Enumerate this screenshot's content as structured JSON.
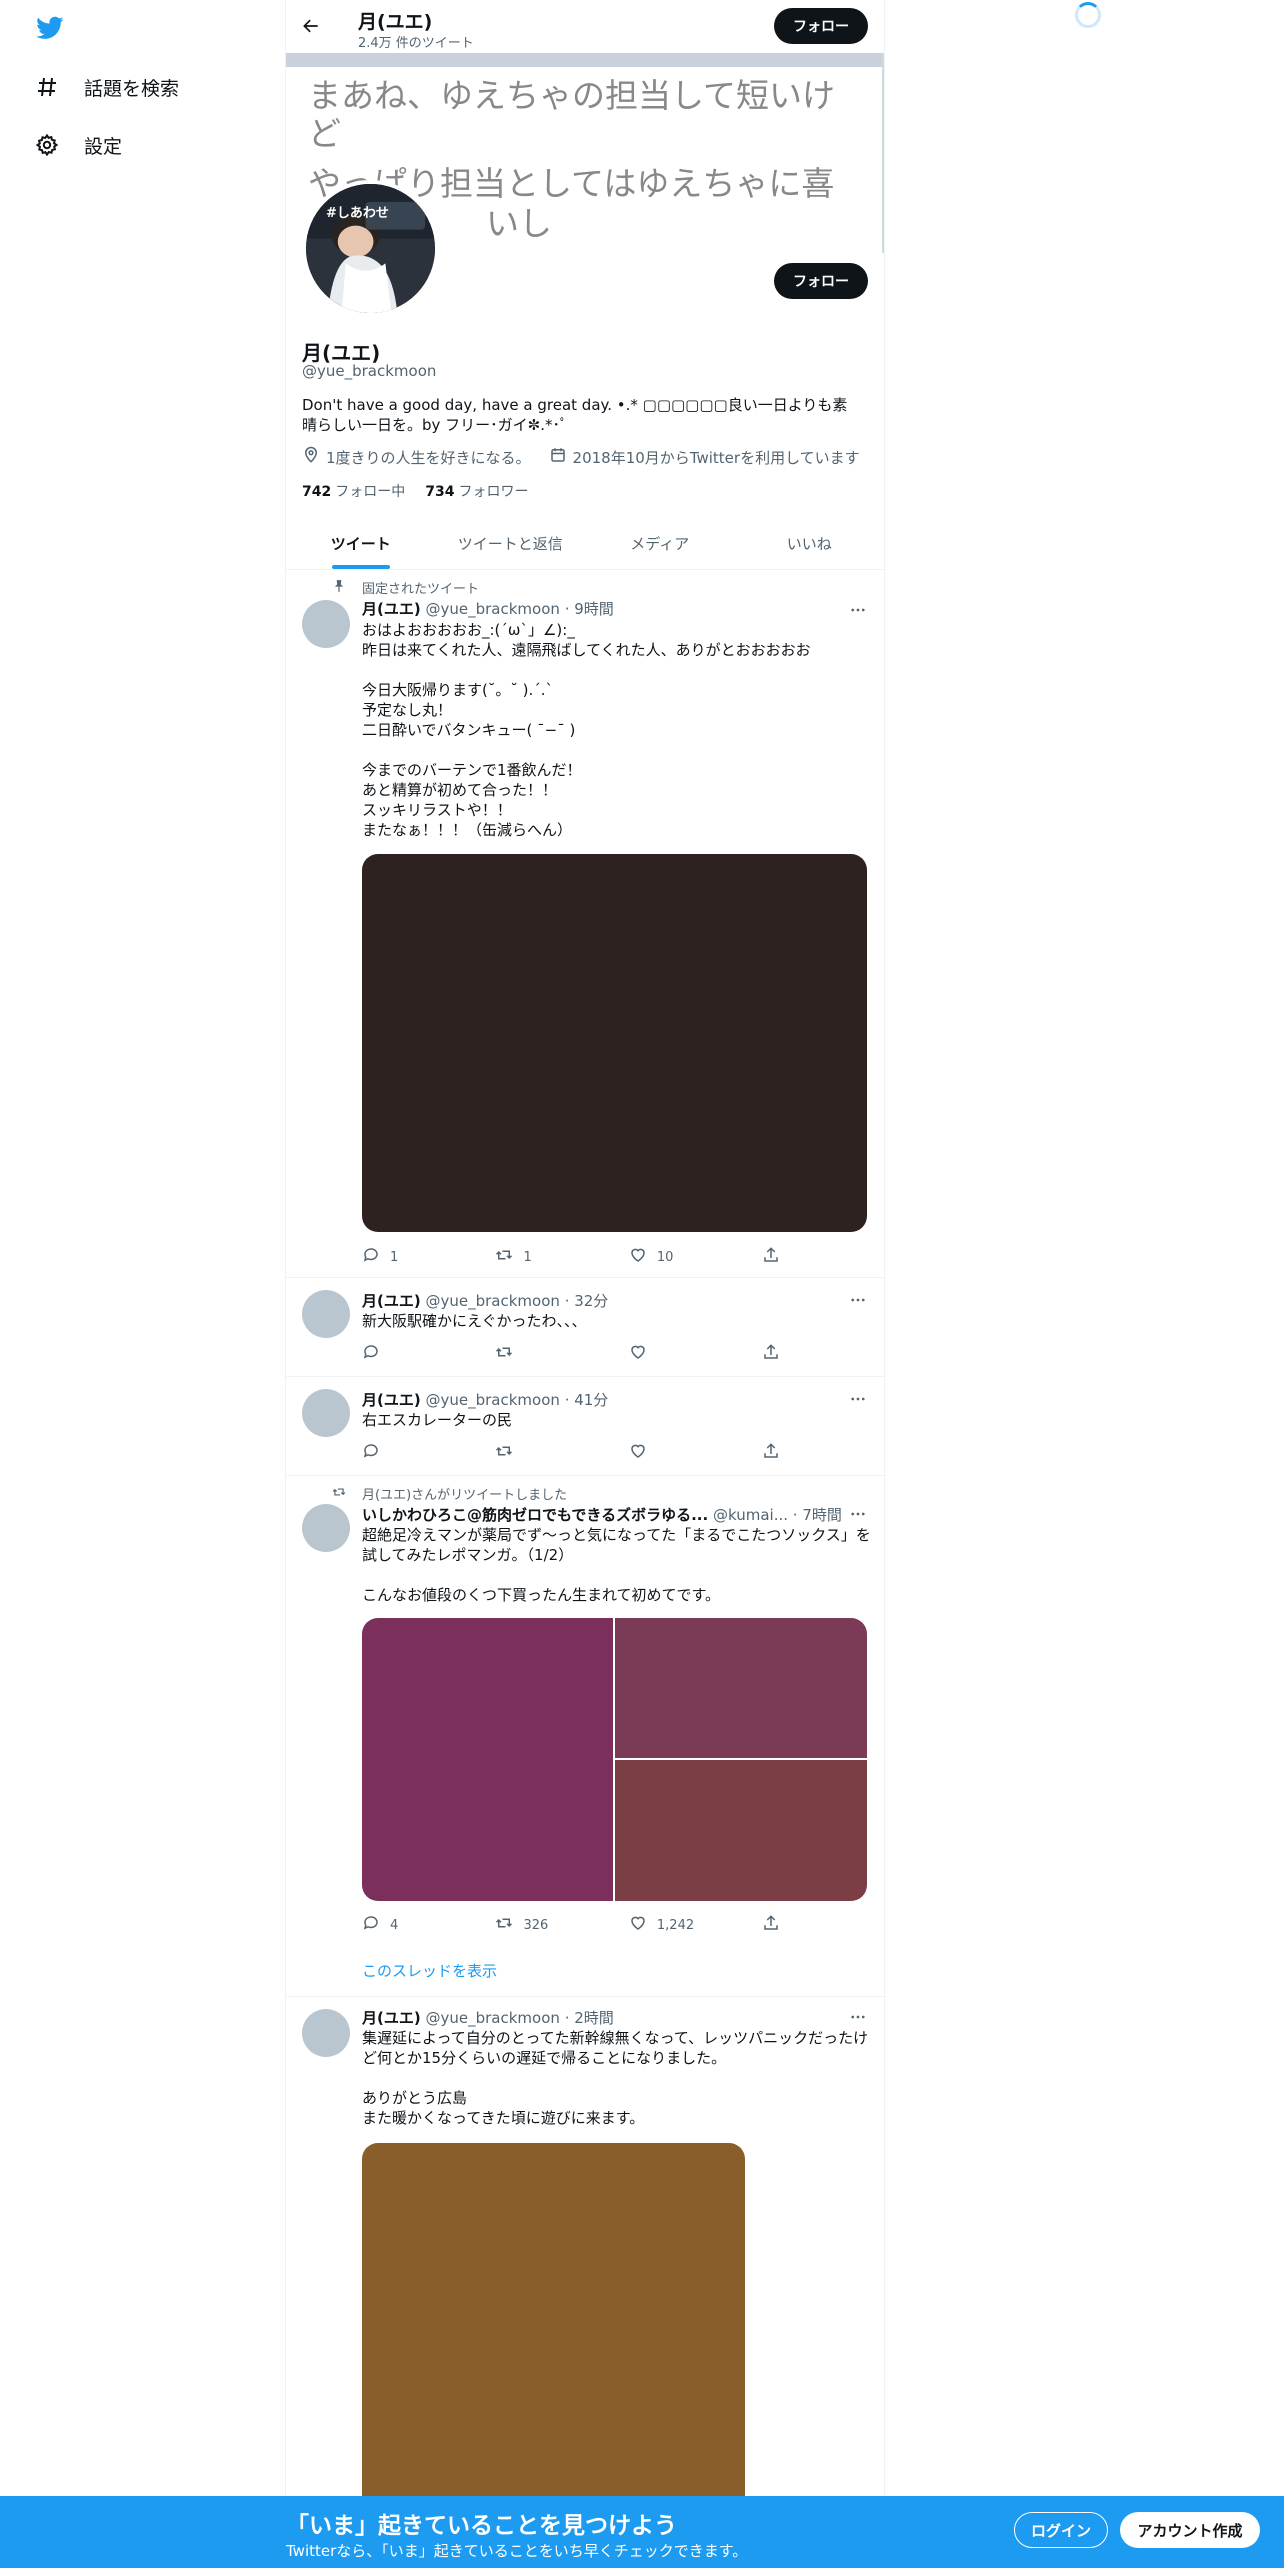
{
  "nav": {
    "explore_label": "話題を検索",
    "settings_label": "設定",
    "brand_color": "#1d9bf0"
  },
  "header": {
    "name": "月(ユエ)",
    "tweet_count": "2.4万 件のツイート",
    "follow_label": "フォロー"
  },
  "banner": {
    "line1": "まあね、ゆえちゃの担当して短いけ",
    "line2": "ど",
    "line3": "やっぱり担当としてはゆえちゃに喜",
    "line4": "いし"
  },
  "avatar": {
    "caption": "#しあわせ"
  },
  "profile": {
    "name": "月(ユエ)",
    "handle": "@yue_brackmoon",
    "bio": "Don't have a good day, have a great day. •.* ▢▢▢▢▢▢良い一日よりも素晴らしい一日を。by フリー･ガイ✼.*･ﾟ",
    "location": "1度きりの人生を好きになる。",
    "joined": "2018年10月からTwitterを利用しています",
    "following_count": "742",
    "following_label": "フォロー中",
    "followers_count": "734",
    "followers_label": "フォロワー",
    "follow_label": "フォロー"
  },
  "tabs": [
    {
      "label": "ツイート"
    },
    {
      "label": "ツイートと返信"
    },
    {
      "label": "メディア"
    },
    {
      "label": "いいね"
    }
  ],
  "tweets": [
    {
      "social": "固定されたツイート",
      "name": "月(ユエ)",
      "handle": "@yue_brackmoon",
      "time": "· 9時間",
      "text": "おはよおおおおお_:(´ω`」∠):_\n昨日は来てくれた人、遠隔飛ばしてくれた人、ありがとおおおおお\n\n今日大阪帰ります(˘。˘ ).ˊ.ˋ\n予定なし丸！\n二日酔いでバタンキュー( ¯−¯ )\n\n今までのバーテンで1番飲んだ！\nあと精算が初めて合った！！\nスッキリラストや！！\nまたなぁ！！！（缶減らへん）",
      "reply": "1",
      "retweet": "1",
      "like": "10",
      "media_color": "#2d2220"
    },
    {
      "name": "月(ユエ)",
      "handle": "@yue_brackmoon",
      "time": "· 32分",
      "text": "新大阪駅確かにえぐかったわ、、、"
    },
    {
      "name": "月(ユエ)",
      "handle": "@yue_brackmoon",
      "time": "· 41分",
      "text": "右エスカレーターの民"
    },
    {
      "social": "月(ユエ)さんがリツイートしました",
      "name": "いしかわひろこ@筋肉ゼロでもできるズボラゆる...",
      "handle": "@kumai...",
      "time": "· 7時間",
      "text": "超絶足冷えマンが薬局でず〜っと気になってた「まるでこたつソックス」を試してみたレポマンガ。（1/2）\n\nこんなお値段のくつ下買ったん生まれて初めてです。",
      "reply": "4",
      "retweet": "326",
      "like": "1,242",
      "media_colors": [
        "#7b2f5a",
        "#7b3a55",
        "#7a3e44"
      ],
      "show_thread": "このスレッドを表示"
    },
    {
      "name": "月(ユエ)",
      "handle": "@yue_brackmoon",
      "time": "· 2時間",
      "text": "集遅延によって自分のとってた新幹線無くなって、レッツパニックだったけど何とか15分くらいの遅延で帰ることになりました。\n\nありがとう広島\nまた暖かくなってきた頃に遊びに来ます。",
      "media_color": "#8a5e2b"
    }
  ],
  "bottom_bar": {
    "title": "「いま」起きていることを見つけよう",
    "subtitle": "Twitterなら、「いま」起きていることをいち早くチェックできます。",
    "login_label": "ログイン",
    "signup_label": "アカウント作成"
  }
}
